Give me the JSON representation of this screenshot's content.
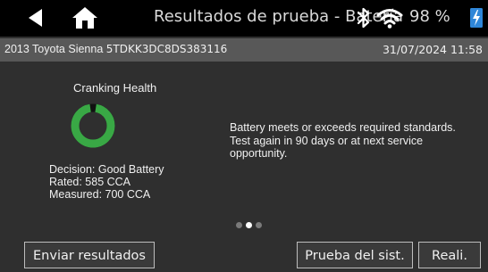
{
  "header": {
    "title": "Resultados de prueba - Batería",
    "battery_percent": "98 %",
    "icons": {
      "back": "back-arrow-icon",
      "home": "home-icon",
      "bluetooth": "bluetooth-icon",
      "wifi": "wifi-icon",
      "charging": "charging-bolt-icon"
    }
  },
  "vehicle_bar": {
    "vehicle": "2013 Toyota Sienna",
    "vin": "5TDKK3DC8DS383116",
    "datetime": "31/07/2024 11:58"
  },
  "result": {
    "title": "Cranking Health",
    "gauge_fraction": 0.95,
    "gauge_color": "#39a845",
    "decision": "Decision:  Good Battery",
    "rated": "Rated:  585 CCA",
    "measured": "Measured:  700 CCA",
    "message": "Battery meets or exceeds required standards. Test again in 90 days or at next service opportunity."
  },
  "pager": {
    "count": 3,
    "active_index": 1
  },
  "buttons": {
    "send": "Enviar resultados",
    "system_test": "Prueba del sist.",
    "done": "Reali."
  },
  "colors": {
    "background": "#2f2f2f",
    "topbar": "#000000",
    "infobar": "#585858",
    "accent_green": "#39a845",
    "charge_blue": "#2f86d8"
  }
}
